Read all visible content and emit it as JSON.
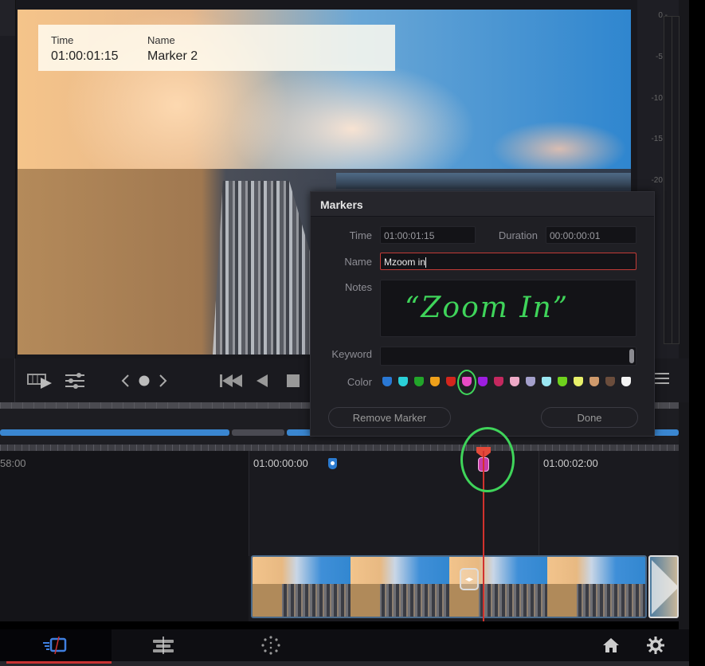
{
  "viewer": {
    "overlay": {
      "time_label": "Time",
      "time_value": "01:00:01:15",
      "name_label": "Name",
      "name_value": "Marker 2"
    }
  },
  "audio_meter": {
    "ticks": [
      "0 -",
      "-5 -",
      "-10 -",
      "-15 -",
      "-20 -"
    ]
  },
  "transport": {
    "icons": [
      "clip-play-icon",
      "sliders-icon",
      "prev-marker-icon",
      "add-marker-icon",
      "next-marker-icon",
      "skip-to-start-icon",
      "reverse-play-icon",
      "stop-icon",
      "menu-icon"
    ]
  },
  "markers_dialog": {
    "title": "Markers",
    "time_label": "Time",
    "time_value": "01:00:01:15",
    "duration_label": "Duration",
    "duration_value": "00:00:00:01",
    "name_label": "Name",
    "name_value": "Mzoom in",
    "notes_label": "Notes",
    "notes_value": "“Zoom In”",
    "keyword_label": "Keyword",
    "keyword_value": "",
    "color_label": "Color",
    "colors": [
      {
        "name": "blue",
        "hex": "#2a78d4"
      },
      {
        "name": "cyan",
        "hex": "#2ad0d8"
      },
      {
        "name": "green",
        "hex": "#22a52a"
      },
      {
        "name": "yellow",
        "hex": "#eea01a"
      },
      {
        "name": "red",
        "hex": "#d3261d"
      },
      {
        "name": "pink",
        "hex": "#e84bc6",
        "selected": true
      },
      {
        "name": "purple",
        "hex": "#9d1de0"
      },
      {
        "name": "fuchsia",
        "hex": "#c4285f"
      },
      {
        "name": "rose",
        "hex": "#eeaac7"
      },
      {
        "name": "lavender",
        "hex": "#a4a0cc"
      },
      {
        "name": "sky",
        "hex": "#9ae6f2"
      },
      {
        "name": "lime",
        "hex": "#6fd21d"
      },
      {
        "name": "mint",
        "hex": "#e8f06a"
      },
      {
        "name": "sand",
        "hex": "#cf9a6c"
      },
      {
        "name": "cocoa",
        "hex": "#6b4d3c"
      },
      {
        "name": "cream",
        "hex": "#f4f4f4"
      }
    ],
    "selected_color": "pink",
    "remove_button": "Remove Marker",
    "done_button": "Done"
  },
  "timeline": {
    "timecodes": [
      "58:00",
      "01:00:00:00",
      "01:00:02:00"
    ],
    "playhead_timecode": "01:00:01:15"
  },
  "bottom_bar": {
    "tabs": [
      "cut-page-icon",
      "edit-page-icon",
      "fusion-icon"
    ],
    "home_icon": "home-icon",
    "settings_icon": "gear-icon"
  },
  "colors": {
    "playhead": "#d2322d",
    "accent_blue": "#3a86d0",
    "annotation_green": "#3fd45a"
  }
}
